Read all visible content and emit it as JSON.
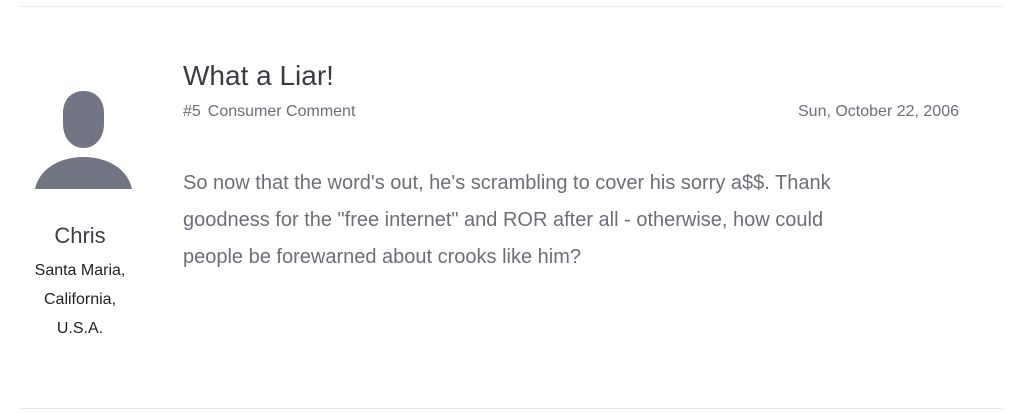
{
  "author": {
    "avatar_icon": "user-silhouette-icon",
    "avatar_color": "#727684",
    "name": "Chris",
    "location_lines": [
      "Santa Maria,",
      "California,",
      "U.S.A."
    ]
  },
  "comment": {
    "title": "What a Liar!",
    "number": "#5",
    "type": "Consumer Comment",
    "date": "Sun, October 22, 2006",
    "body_lines": [
      "So now that the word's out, he's scrambling to cover his sorry a$$. Thank",
      "goodness for the \"free internet\" and ROR after all - otherwise, how could",
      "people be forewarned about crooks like him?"
    ]
  }
}
